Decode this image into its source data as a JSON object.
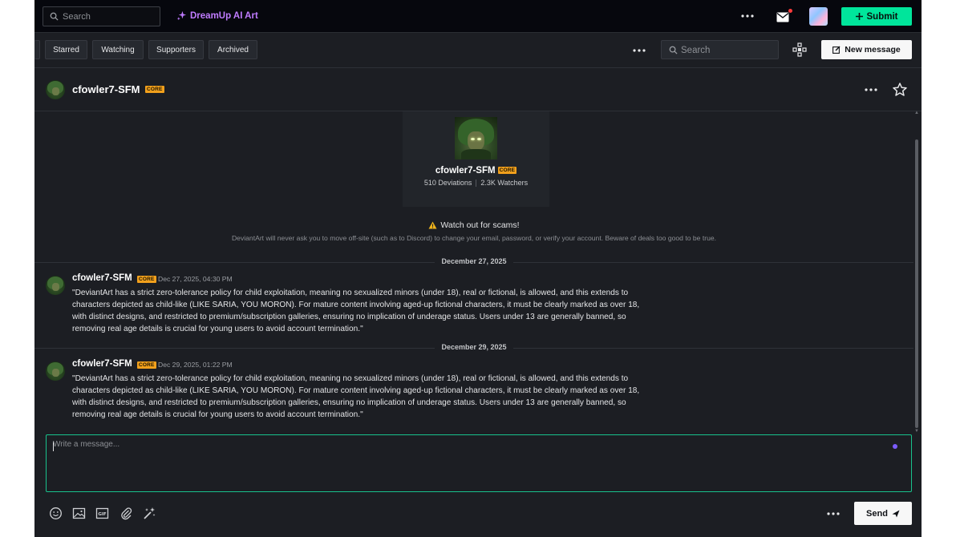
{
  "topbar": {
    "search_placeholder": "Search",
    "dreamup_label": "DreamUp AI Art",
    "submit_label": "Submit"
  },
  "filters": {
    "chips": [
      "Starred",
      "Watching",
      "Supporters",
      "Archived"
    ],
    "search_placeholder": "Search",
    "new_message_label": "New message"
  },
  "conversation": {
    "username": "cfowler7-SFM",
    "badge": "CORE",
    "profile": {
      "username": "cfowler7-SFM",
      "badge": "CORE",
      "deviations": "510 Deviations",
      "watchers": "2.3K Watchers"
    },
    "scam_warning": {
      "title": "Watch out for scams!",
      "text": "DeviantArt will never ask you to move off-site (such as to Discord) to change your email, password, or verify your account. Beware of deals too good to be true."
    },
    "messages": [
      {
        "date_separator": "December 27, 2025",
        "author": "cfowler7-SFM",
        "badge": "CORE",
        "timestamp": "Dec 27, 2025, 04:30 PM",
        "lines": [
          "\"DeviantArt has a strict zero-tolerance policy for child exploitation, meaning no sexualized minors (under 18), real or fictional, is allowed, and this extends to",
          "characters depicted as child-like (LIKE SARIA, YOU MORON). For mature content involving aged-up fictional characters, it must be clearly marked as over 18,",
          "with distinct designs, and restricted to premium/subscription galleries, ensuring no implication of underage status. Users under 13 are generally banned, so",
          "removing real age details is crucial for young users to avoid account termination.\""
        ]
      },
      {
        "date_separator": "December 29, 2025",
        "author": "cfowler7-SFM",
        "badge": "CORE",
        "timestamp": "Dec 29, 2025, 01:22 PM",
        "lines": [
          "\"DeviantArt has a strict zero-tolerance policy for child exploitation, meaning no sexualized minors (under 18), real or fictional, is allowed, and this extends to",
          "characters depicted as child-like (LIKE SARIA, YOU MORON). For mature content involving aged-up fictional characters, it must be clearly marked as over 18,",
          "with distinct designs, and restricted to premium/subscription galleries, ensuring no implication of underage status. Users under 13 are generally banned, so",
          "removing real age details is crucial for young users to avoid account termination.\""
        ]
      }
    ]
  },
  "composer": {
    "placeholder": "Write a message...",
    "send_label": "Send"
  },
  "colors": {
    "submit": "#00e59b",
    "dreamup": "#c07cff",
    "core_badge": "#f1a01c",
    "composer_border": "#18c28c",
    "notification_dot": "#ff3b3b"
  },
  "icons": {
    "topbar": [
      "search-icon",
      "sparkle-icon",
      "more-icon",
      "mail-icon",
      "avatar",
      "plus-icon"
    ],
    "filters": [
      "more-icon",
      "search-icon",
      "network-icon",
      "edit-icon"
    ],
    "header": [
      "more-icon",
      "star-icon"
    ],
    "composer_tools": [
      "emoji-icon",
      "image-icon",
      "gif-icon",
      "attach-icon",
      "magic-wand-icon",
      "more-icon",
      "send-icon"
    ]
  }
}
